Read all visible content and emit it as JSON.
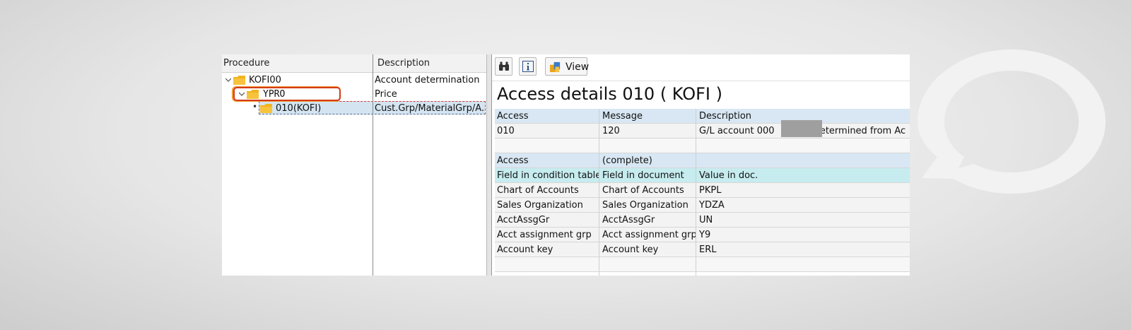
{
  "tree": {
    "columns": {
      "procedure": "Procedure",
      "description": "Description"
    },
    "rows": [
      {
        "name": "KOFI00",
        "description": "Account determination"
      },
      {
        "name": "YPRO",
        "description": "Price"
      },
      {
        "name": "010(KOFI)",
        "description": "Cust.Grp/MaterialGrp/A..."
      }
    ]
  },
  "toolbar": {
    "view_label": "View",
    "find_icon": "binoculars-icon",
    "info_icon": "info-icon"
  },
  "detail": {
    "title": "Access details 010 ( KOFI )",
    "header": {
      "c1": "Access",
      "c2": "Message",
      "c3": "Description"
    },
    "access_row": {
      "c1": "010",
      "c2": "120",
      "c3_prefix": "G/L account 000",
      "c3_suffix": "determined from Ac"
    },
    "section_row": {
      "c1": "Access",
      "c2": "(complete)",
      "c3": ""
    },
    "field_header": {
      "c1": "Field in condition table",
      "c2": "Field in document",
      "c3": "Value in doc."
    },
    "fields": [
      {
        "c1": "Chart of Accounts",
        "c2": "Chart of Accounts",
        "c3": "PKPL"
      },
      {
        "c1": "Sales Organization",
        "c2": "Sales Organization",
        "c3": "YDZA"
      },
      {
        "c1": "AcctAssgGr",
        "c2": "AcctAssgGr",
        "c3": "UN"
      },
      {
        "c1": "Acct assignment grp",
        "c2": "Acct assignment grp",
        "c3": "Y9"
      },
      {
        "c1": "Account key",
        "c2": "Account key",
        "c3": "ERL"
      }
    ]
  },
  "colors": {
    "folder": "#f2b420",
    "selection": "#d4e4f0",
    "header": "#d8e7f3",
    "subheader": "#c6ecef",
    "marker": "#d43a1a"
  }
}
